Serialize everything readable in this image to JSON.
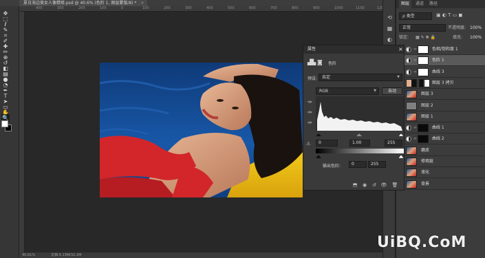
{
  "document": {
    "tab_title": "夏日海边美女人像精修.psd @ 40.6% (色阶 1, 图层蒙版/8) *",
    "close_glyph": "×"
  },
  "ruler": {
    "top_ticks": [
      "400",
      "300",
      "200",
      "100",
      "0",
      "100",
      "200",
      "300",
      "400",
      "500",
      "600",
      "700",
      "800",
      "900",
      "1000",
      "1100",
      "1200",
      "1300"
    ]
  },
  "status": {
    "zoom": "40.61%",
    "doc_size": "文档:5.13M/32.2M"
  },
  "tools": [
    {
      "name": "move-tool-icon",
      "glyph": "✥"
    },
    {
      "name": "marquee-tool-icon",
      "glyph": "⬚"
    },
    {
      "name": "lasso-tool-icon",
      "glyph": "ℓ"
    },
    {
      "name": "quick-select-tool-icon",
      "glyph": "✎"
    },
    {
      "name": "crop-tool-icon",
      "glyph": "⌗"
    },
    {
      "name": "eyedropper-tool-icon",
      "glyph": "✐"
    },
    {
      "name": "healing-brush-tool-icon",
      "glyph": "✚"
    },
    {
      "name": "brush-tool-icon",
      "glyph": "✏"
    },
    {
      "name": "clone-stamp-tool-icon",
      "glyph": "⊕"
    },
    {
      "name": "history-brush-tool-icon",
      "glyph": "↺"
    },
    {
      "name": "eraser-tool-icon",
      "glyph": "◧"
    },
    {
      "name": "gradient-tool-icon",
      "glyph": "▤"
    },
    {
      "name": "blur-tool-icon",
      "glyph": "●"
    },
    {
      "name": "dodge-tool-icon",
      "glyph": "◔"
    },
    {
      "name": "pen-tool-icon",
      "glyph": "✒"
    },
    {
      "name": "type-tool-icon",
      "glyph": "T"
    },
    {
      "name": "path-select-tool-icon",
      "glyph": "➤"
    },
    {
      "name": "shape-tool-icon",
      "glyph": "▭"
    },
    {
      "name": "hand-tool-icon",
      "glyph": "✋"
    },
    {
      "name": "zoom-tool-icon",
      "glyph": "🔍"
    },
    {
      "name": "more-tools-icon",
      "glyph": "⋯"
    }
  ],
  "layers_panel": {
    "tabs": [
      "图层",
      "通道",
      "路径"
    ],
    "kind_label": "ρ 类型",
    "blend_mode": "正常",
    "opacity_label": "不透明度:",
    "opacity_value": "100%",
    "lock_label": "锁定:",
    "fill_label": "填充:",
    "fill_value": "100%",
    "layers": [
      {
        "name": "色相/饱和度 1",
        "kind": "adjustment",
        "selected": false
      },
      {
        "name": "色阶 1",
        "kind": "adjustment",
        "selected": true
      },
      {
        "name": "曲线 3",
        "kind": "adjustment",
        "selected": false
      },
      {
        "name": "图层 3 拷贝",
        "kind": "pixel-mask",
        "selected": false
      },
      {
        "name": "图层 3",
        "kind": "pixel",
        "selected": false
      },
      {
        "name": "图层 2",
        "kind": "pixel-gray",
        "selected": false
      },
      {
        "name": "图层 1",
        "kind": "pixel",
        "selected": false
      },
      {
        "name": "曲线 1",
        "kind": "adjustment-dark",
        "selected": false
      },
      {
        "name": "曲线 2",
        "kind": "adjustment-dark",
        "selected": false
      },
      {
        "name": "磨皮",
        "kind": "pixel",
        "selected": false
      },
      {
        "name": "修瑕疵",
        "kind": "pixel",
        "selected": false
      },
      {
        "name": "液化",
        "kind": "pixel",
        "selected": false
      },
      {
        "name": "背景",
        "kind": "pixel",
        "selected": false
      }
    ]
  },
  "properties_panel": {
    "title": "属性",
    "close_glyph": "×",
    "menu_glyph": "≡",
    "adjustment_name": "色阶",
    "preset_label": "预设:",
    "preset_value": "自定",
    "channel_value": "RGB",
    "auto_label": "自动",
    "input_black": "0",
    "input_gamma": "1.00",
    "input_white": "255",
    "output_label": "输出色阶:",
    "output_black": "0",
    "output_white": "255"
  },
  "watermark": {
    "text": "UiBQ.CoM"
  },
  "colors": {
    "accent_selected": "#5a5a5a",
    "foreground_swatch": "#ffffff",
    "background_swatch": "#000000"
  }
}
